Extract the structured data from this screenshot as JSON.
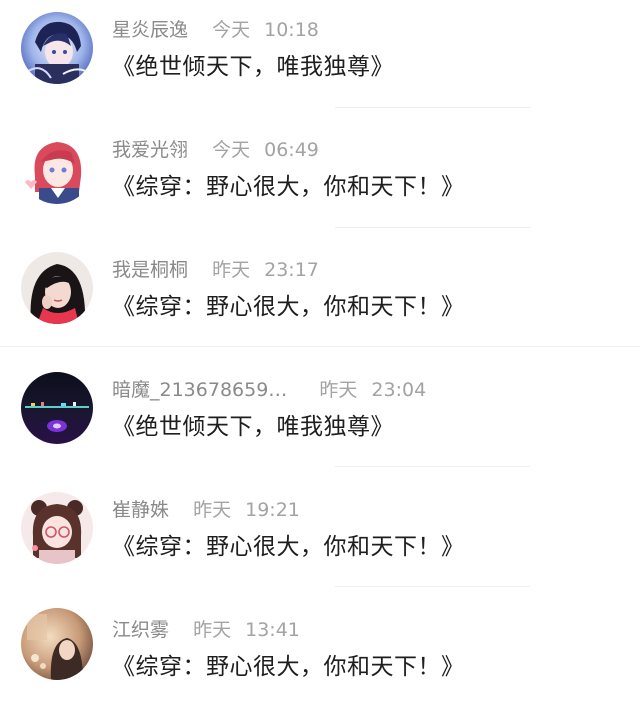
{
  "conversations": [
    {
      "name": "星炎辰逸",
      "day": "今天",
      "time": "10:18",
      "message": "《绝世倾天下，唯我独尊》",
      "avatar_icon": "anime-boy-avatar"
    },
    {
      "name": "我爱光翎",
      "day": "今天",
      "time": "06:49",
      "message": "《综穿：野心很大，你和天下！》",
      "avatar_icon": "anime-girl-red-hair-avatar"
    },
    {
      "name": "我是桐桐",
      "day": "昨天",
      "time": "23:17",
      "message": "《综穿：野心很大，你和天下！》",
      "avatar_icon": "girl-photo-avatar"
    },
    {
      "name": "暗魔_213678659…",
      "day": "昨天",
      "time": "23:04",
      "message": "《绝世倾天下，唯我独尊》",
      "avatar_icon": "night-city-avatar"
    },
    {
      "name": "崔静姝",
      "day": "昨天",
      "time": "19:21",
      "message": "《综穿：野心很大，你和天下！》",
      "avatar_icon": "illustrated-girl-avatar"
    },
    {
      "name": "江织雾",
      "day": "昨天",
      "time": "13:41",
      "message": "《综穿：野心很大，你和天下！》",
      "avatar_icon": "warm-photo-avatar"
    }
  ]
}
